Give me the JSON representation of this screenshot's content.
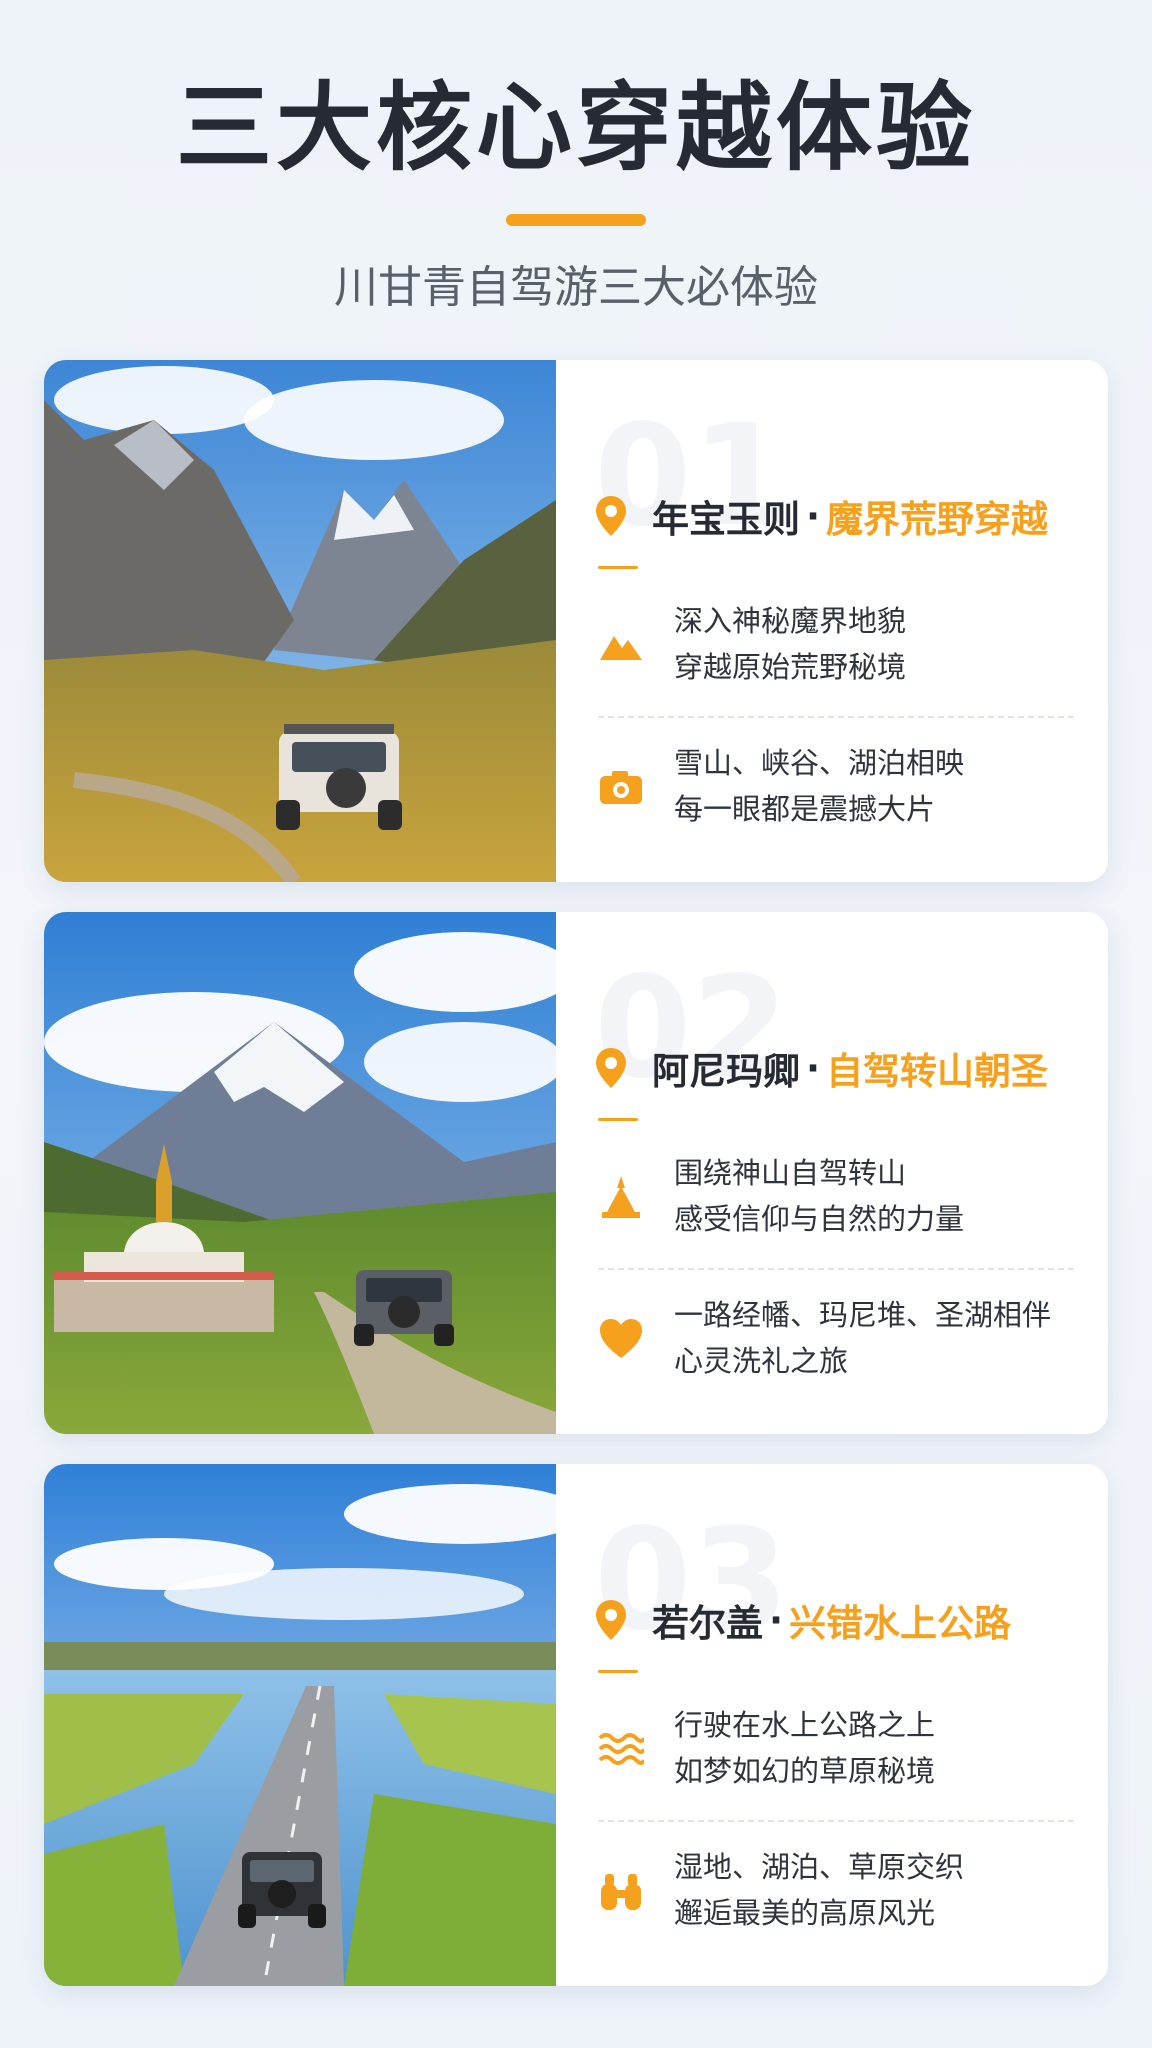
{
  "header": {
    "title": "三大核心穿越体验",
    "subtitle": "川甘青自驾游三大必体验"
  },
  "accent_color": "#f6a11e",
  "cards": [
    {
      "number": "01",
      "place": "年宝玉则",
      "separator": "·",
      "theme": "魔界荒野穿越",
      "features": [
        {
          "icon": "mountain-icon",
          "line1": "深入神秘魔界地貌",
          "line2": "穿越原始荒野秘境"
        },
        {
          "icon": "camera-icon",
          "line1": "雪山、峡谷、湖泊相映",
          "line2": "每一眼都是震撼大片"
        }
      ]
    },
    {
      "number": "02",
      "place": "阿尼玛卿",
      "separator": "·",
      "theme": "自驾转山朝圣",
      "features": [
        {
          "icon": "stupa-icon",
          "line1": "围绕神山自驾转山",
          "line2": "感受信仰与自然的力量"
        },
        {
          "icon": "heart-icon",
          "line1": "一路经幡、玛尼堆、圣湖相伴",
          "line2": "心灵洗礼之旅"
        }
      ]
    },
    {
      "number": "03",
      "place": "若尔盖",
      "separator": "·",
      "theme": "兴错水上公路",
      "features": [
        {
          "icon": "waves-icon",
          "line1": "行驶在水上公路之上",
          "line2": "如梦如幻的草原秘境"
        },
        {
          "icon": "binoculars-icon",
          "line1": "湿地、湖泊、草原交织",
          "line2": "邂逅最美的高原风光"
        }
      ]
    }
  ]
}
